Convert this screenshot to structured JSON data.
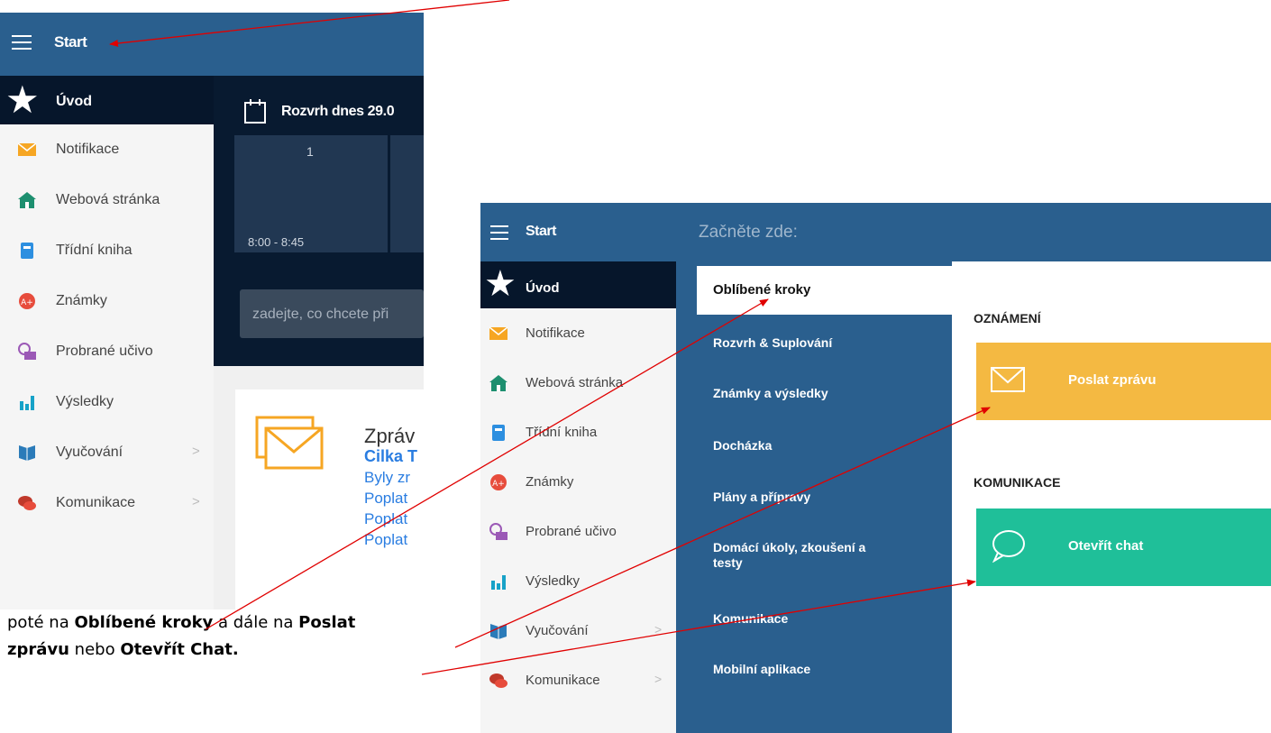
{
  "left_screen": {
    "header_title": "Start",
    "home_label": "Úvod",
    "menu": [
      {
        "label": "Notifikace",
        "icon": "envelope-icon"
      },
      {
        "label": "Webová stránka",
        "icon": "home-icon"
      },
      {
        "label": "Třídní kniha",
        "icon": "book-icon"
      },
      {
        "label": "Známky",
        "icon": "grades-icon"
      },
      {
        "label": "Probrané učivo",
        "icon": "clock-icon"
      },
      {
        "label": "Výsledky",
        "icon": "bar-chart-icon"
      },
      {
        "label": "Vyučování",
        "icon": "open-book-icon",
        "chevron": ">"
      },
      {
        "label": "Komunikace",
        "icon": "chat-icon",
        "chevron": ">"
      }
    ],
    "schedule_title": "Rozvrh dnes 29.0",
    "lesson_number": "1",
    "lesson_time": "8:00 - 8:45",
    "search_placeholder": "zadejte, co chcete při",
    "message_card": {
      "title": "Zpráv",
      "sender": "Cilka T",
      "lines": [
        "Byly zr",
        "Poplat",
        "Poplat",
        "Poplat"
      ]
    }
  },
  "right_screen": {
    "header_title": "Start",
    "header_prompt": "Začněte zde:",
    "home_label": "Úvod",
    "menu": [
      {
        "label": "Notifikace",
        "icon": "envelope-icon"
      },
      {
        "label": "Webová stránka",
        "icon": "home-icon"
      },
      {
        "label": "Třídní kniha",
        "icon": "book-icon"
      },
      {
        "label": "Známky",
        "icon": "grades-icon"
      },
      {
        "label": "Probrané učivo",
        "icon": "clock-icon"
      },
      {
        "label": "Výsledky",
        "icon": "bar-chart-icon"
      },
      {
        "label": "Vyučování",
        "icon": "open-book-icon",
        "chevron": ">"
      },
      {
        "label": "Komunikace",
        "icon": "chat-icon",
        "chevron": ">"
      }
    ],
    "categories": [
      "Oblíbené kroky",
      "Rozvrh & Suplování",
      "Známky a výsledky",
      "Docházka",
      "Plány a přípravy",
      "Domácí úkoly, zkoušení a testy",
      "Komunikace",
      "Mobilní aplikace"
    ],
    "section_announcements": "OZNÁMENÍ",
    "send_message_button": "Poslat zprávu",
    "section_communication": "KOMUNIKACE",
    "open_chat_button": "Otevřít chat"
  },
  "caption": {
    "t1": "poté na ",
    "b1": "Oblíbené kroky",
    "t2": " a dále na ",
    "b2": "Poslat",
    "b3": "zprávu",
    "t3": " nebo ",
    "b4": "Otevřít Chat."
  },
  "colors": {
    "header_blue": "#2a5f8e",
    "dark_navy": "#06162b",
    "send_tile": "#f4b942",
    "chat_tile": "#1fbf99",
    "arrow_red": "#e00000"
  }
}
